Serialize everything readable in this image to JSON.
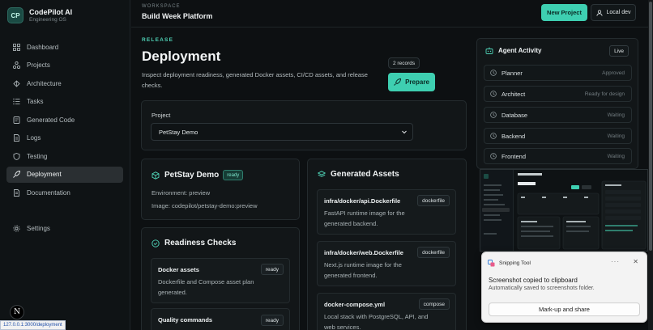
{
  "brand": {
    "logo": "CP",
    "name": "CodePilot AI",
    "subtitle": "Engineering OS"
  },
  "sidebar": {
    "items": [
      {
        "label": "Dashboard",
        "icon": "grid-icon"
      },
      {
        "label": "Projects",
        "icon": "projects-icon"
      },
      {
        "label": "Architecture",
        "icon": "architecture-icon"
      },
      {
        "label": "Tasks",
        "icon": "tasks-icon"
      },
      {
        "label": "Generated Code",
        "icon": "code-icon"
      },
      {
        "label": "Logs",
        "icon": "logs-icon"
      },
      {
        "label": "Testing",
        "icon": "shield-icon"
      },
      {
        "label": "Deployment",
        "icon": "rocket-icon",
        "active": true
      },
      {
        "label": "Documentation",
        "icon": "doc-icon"
      }
    ],
    "settings": "Settings"
  },
  "header": {
    "workspace_label": "WORKSPACE",
    "workspace_title": "Build Week Platform",
    "new_project": "New Project",
    "local_dev": "Local dev"
  },
  "main": {
    "eyebrow": "RELEASE",
    "title": "Deployment",
    "description": "Inspect deployment readiness, generated Docker assets, CI/CD assets, and release checks.",
    "records": "2 records",
    "prepare": "Prepare",
    "project": {
      "label": "Project",
      "selected": "PetStay Demo"
    },
    "petstay": {
      "title": "PetStay Demo",
      "badge": "ready",
      "environment": "Environment: preview",
      "image": "Image: codepilot/petstay-demo:preview"
    },
    "readiness": {
      "title": "Readiness Checks",
      "items": [
        {
          "title": "Docker assets",
          "status": "ready",
          "desc": "Dockerfile and Compose asset plan generated."
        },
        {
          "title": "Quality commands",
          "status": "ready",
          "desc": ""
        }
      ]
    },
    "assets": {
      "title": "Generated Assets",
      "items": [
        {
          "path": "infra/docker/api.Dockerfile",
          "tag": "dockerfile",
          "desc": "FastAPI runtime image for the generated backend."
        },
        {
          "path": "infra/docker/web.Dockerfile",
          "tag": "dockerfile",
          "desc": "Next.js runtime image for the generated frontend."
        },
        {
          "path": "docker-compose.yml",
          "tag": "compose",
          "desc": "Local stack with PostgreSQL, API, and web services."
        }
      ]
    }
  },
  "agent_activity": {
    "title": "Agent Activity",
    "badge": "Live",
    "agents": [
      {
        "name": "Planner",
        "status": "Approved"
      },
      {
        "name": "Architect",
        "status": "Ready for design"
      },
      {
        "name": "Database",
        "status": "Waiting"
      },
      {
        "name": "Backend",
        "status": "Waiting"
      },
      {
        "name": "Frontend",
        "status": "Waiting"
      }
    ]
  },
  "snipping_tool": {
    "app": "Snipping Tool",
    "message": "Screenshot copied to clipboard",
    "sub": "Automatically saved to screenshots folder.",
    "button": "Mark-up and share",
    "thumb": {
      "brand": "CodePilot AI",
      "title": "Testing"
    }
  },
  "status_url": "127.0.0.1:3000/deployment",
  "avatar_letter": "N",
  "colors": {
    "accent": "#3ecfb1",
    "background": "#0d1012",
    "panel": "#121618"
  }
}
